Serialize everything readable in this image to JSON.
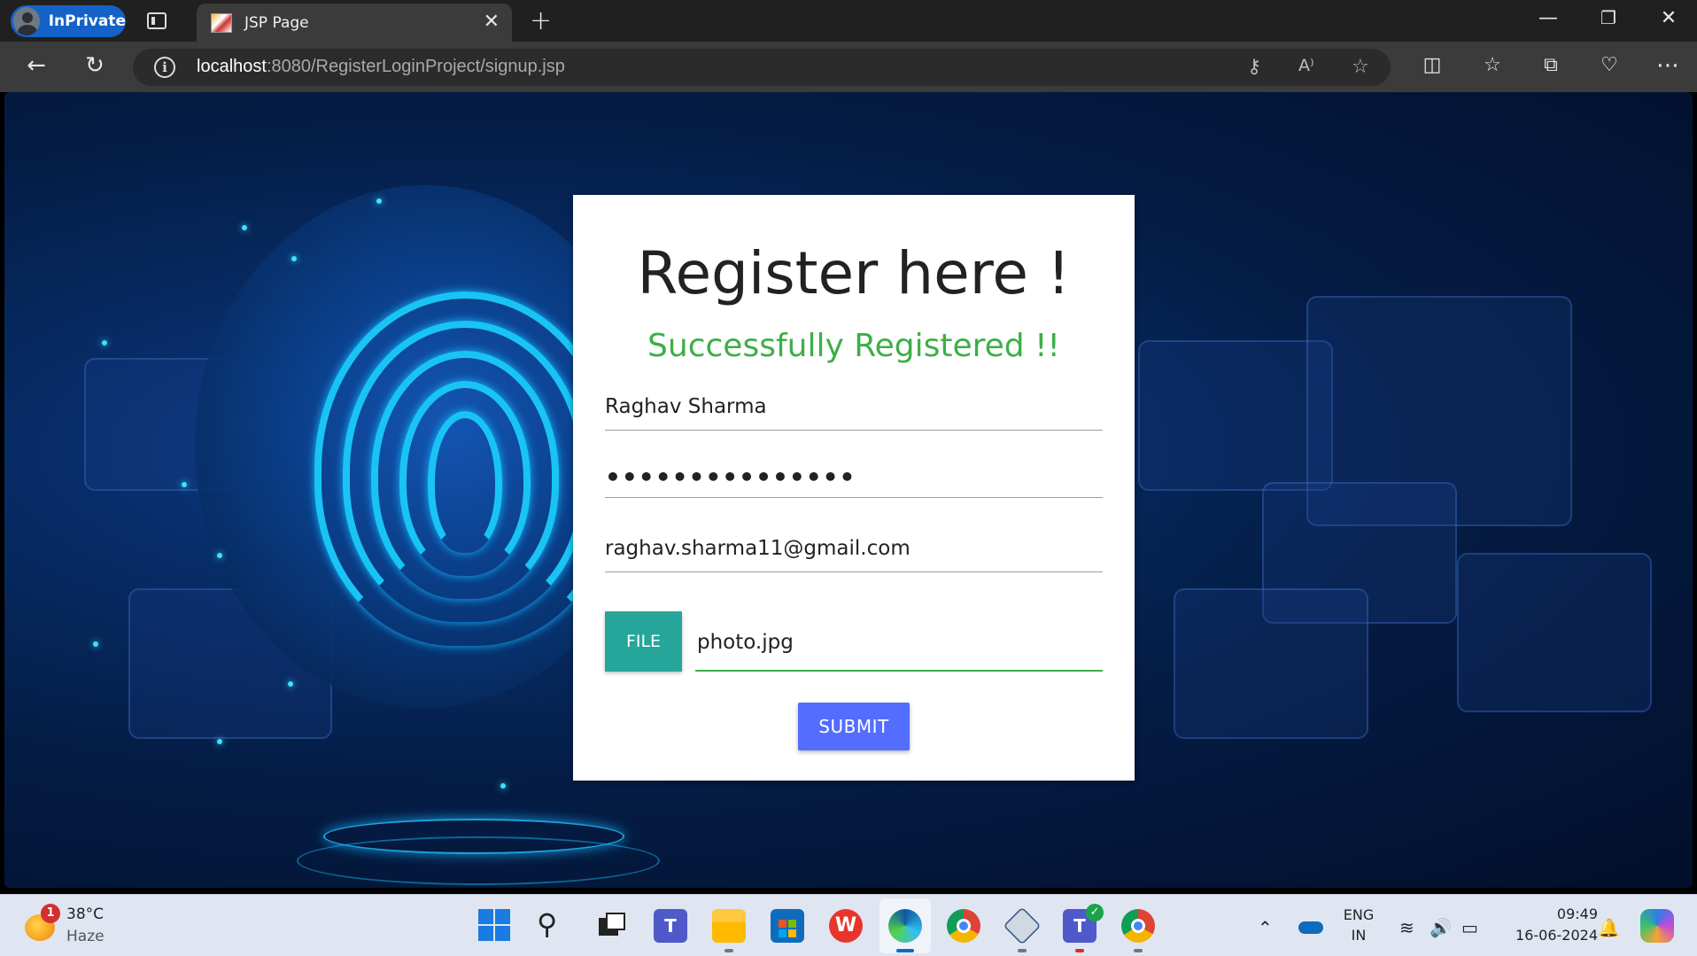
{
  "browser": {
    "profile_label": "InPrivate",
    "tab_title": "JSP Page",
    "url_host": "localhost",
    "url_rest": ":8080/RegisterLoginProject/signup.jsp"
  },
  "form": {
    "heading": "Register here !",
    "status_message": "Successfully Registered !!",
    "name_value": "Raghav Sharma",
    "password_mask": "•••••••••••••••",
    "email_value": "raghav.sharma11@gmail.com",
    "file_button_label": "FILE",
    "file_name": "photo.jpg",
    "submit_label": "SUBMIT"
  },
  "colors": {
    "success_green": "#3daf47",
    "file_button": "#26a69a",
    "submit_button": "#536dfe",
    "inprivate_badge": "#1462c8"
  },
  "taskbar": {
    "weather_temp": "38°C",
    "weather_desc": "Haze",
    "weather_badge": "1",
    "language_top": "ENG",
    "language_bottom": "IN",
    "time": "09:49",
    "date": "16-06-2024",
    "apps": [
      "start-icon",
      "search-icon",
      "task-view-icon",
      "teams-icon",
      "file-explorer-icon",
      "store-icon",
      "wps-office-icon",
      "edge-icon",
      "chrome-icon",
      "virtualbox-icon",
      "teams-new-icon",
      "chrome-profile-icon"
    ]
  }
}
